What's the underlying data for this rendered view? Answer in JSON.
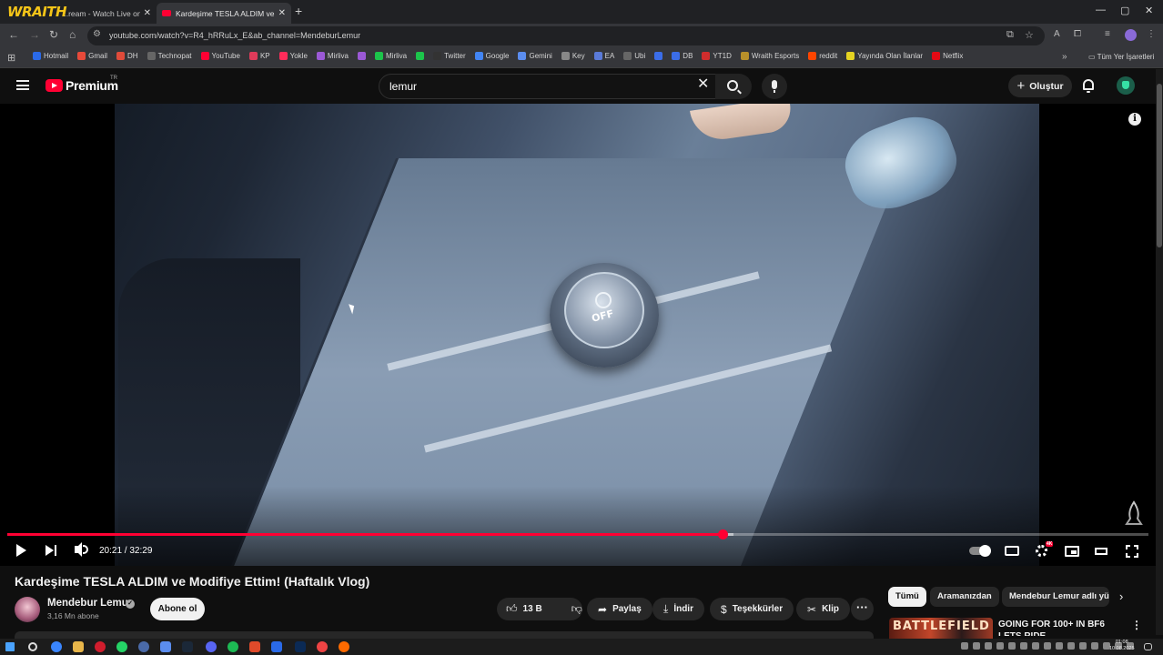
{
  "browser": {
    "tabs": [
      {
        "title": "...ream - Watch Live on",
        "active": false
      },
      {
        "title": "Kardeşime TESLA ALDIM ve Mo",
        "active": true
      }
    ],
    "overlay_logo": "WRAITH",
    "url": "youtube.com/watch?v=R4_hRRuLx_E&ab_channel=MendeburLemur",
    "bookmarks": [
      "Hotmail",
      "Gmail",
      "DH",
      "Technopat",
      "YouTube",
      "KP",
      "Yokle",
      "Mirliva",
      "",
      "Mirliva",
      "",
      "Twitter",
      "Google",
      "Gemini",
      "Key",
      "EA",
      "Ubi",
      "",
      "DB",
      "YT1D",
      "Wraith Esports",
      "reddit",
      "Yayında Olan İlanlar",
      "Netflix"
    ],
    "bookmark_colors": [
      "#2a6ae8",
      "#e84a3a",
      "#e04b3a",
      "#666",
      "#ff0033",
      "#e03b5a",
      "#ff2c5a",
      "#9b59d6",
      "#9b59d6",
      "#1cc44b",
      "#1cc44b",
      "#333",
      "#4285f4",
      "#5b8def",
      "#888",
      "#5a7ad8",
      "#666",
      "#3b6de8",
      "#3b6de8",
      "#d02d2d",
      "#b8902a",
      "#ff4500",
      "#e5d321",
      "#e50914"
    ],
    "all_bookmarks_label": "Tüm Yer İşaretleri"
  },
  "youtube": {
    "brand": "Premium",
    "region": "TR",
    "search_value": "lemur",
    "create_label": "Oluştur",
    "player": {
      "time_current": "20:21",
      "time_total": "32:29",
      "timecode": "20:21 / 32:29",
      "progress_fraction": 0.6267,
      "buffered_fraction": 0.636,
      "overlay_off_text": "OFF",
      "info_label": "i",
      "hd_badge": "4K"
    },
    "video": {
      "title": "Kardeşime TESLA ALDIM ve Modifiye Ettim! (Haftalık Vlog)",
      "channel": "Mendebur Lemur",
      "subscribers": "3,16 Mn abone",
      "subscribe_label": "Abone ol",
      "likes": "13 B",
      "share_label": "Paylaş",
      "download_label": "İndir",
      "thanks_label": "Teşekkürler",
      "clip_label": "Klip",
      "more_label": "···"
    },
    "chips": [
      "Tümü",
      "Aramanızdan",
      "Mendebur Lemur adlı yü"
    ],
    "related": [
      {
        "thumb_text": "BATTLEFIELD",
        "title": "GOING FOR 100+ IN BF6 LETS RIDE"
      }
    ]
  },
  "taskbar": {
    "clock_time": "01:08",
    "clock_date": "10.08.2025"
  }
}
